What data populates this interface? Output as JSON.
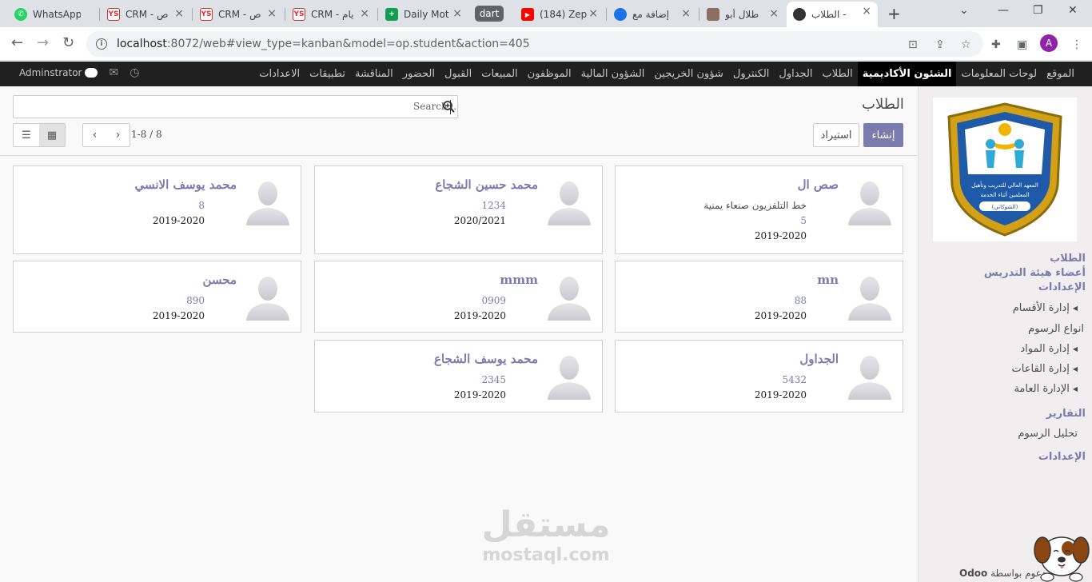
{
  "browser": {
    "tabs": [
      {
        "title": "WhatsApp",
        "fav": "whatsapp",
        "color": "#25d366"
      },
      {
        "title": "CRM - ص",
        "fav": "ys",
        "color": "#fff"
      },
      {
        "title": "CRM - ص",
        "fav": "ys",
        "color": "#fff"
      },
      {
        "title": "CRM - يام",
        "fav": "ys",
        "color": "#fff"
      },
      {
        "title": "Daily Mot",
        "fav": "sheets",
        "color": "#0f9d58"
      },
      {
        "title": "(184) Zep",
        "fav": "youtube",
        "color": "#ff0000"
      },
      {
        "title": "إضافة مع",
        "fav": "circle",
        "color": "#1a73e8"
      },
      {
        "title": "طلال أبو",
        "fav": "book",
        "color": "#8d6e63"
      },
      {
        "title": "الطلاب -",
        "fav": "odoo",
        "color": "#333"
      }
    ],
    "group_label": "dart",
    "url_host": "localhost",
    "url_rest": ":8072/web#view_type=kanban&model=op.student&action=405"
  },
  "menu": {
    "items": [
      "الموقع",
      "لوحات المعلومات",
      "الشئون الأكاديمية",
      "الطلاب",
      "الجداول",
      "الكنترول",
      "شؤون الخريجين",
      "الشؤون المالية",
      "الموظفون",
      "المبيعات",
      "القبول",
      "الحضور",
      "المناقشة",
      "تطبيقات",
      "الاعدادات"
    ],
    "active_index": 2,
    "user": "Adminstrator"
  },
  "control": {
    "breadcrumb": "الطلاب",
    "search_placeholder": "Search...",
    "create_label": "إنشاء",
    "import_label": "استيراد",
    "pager_value": "1-8 / 8"
  },
  "sidebar": {
    "heads": [
      "الطلاب",
      "أعضاء هيئة التدريس",
      "الإعدادات"
    ],
    "sub_items": [
      "إدارة الأقسام",
      "انواع الرسوم",
      "إدارة المواد",
      "إدارة القاعات",
      "الإدارة العامة"
    ],
    "reports_head": "التقارير",
    "report_item": "تحليل الرسوم",
    "settings_head": "الإعدادات",
    "logo_text": [
      "المعهد العالي للتدريب وتأهيل",
      "المعلمين أثناء الخدمة",
      "(الشوكاني)"
    ]
  },
  "cards": [
    {
      "name": "صص ال",
      "line1": "خط التلفزيون صنعاء يمنية",
      "line2": "5",
      "line3": "2019-2020"
    },
    {
      "name": "محمد حسين الشجاع",
      "line1": "",
      "line2": "1234",
      "line3": "2020/2021"
    },
    {
      "name": "محمد يوسف الانسي",
      "line1": "",
      "line2": "8",
      "line3": "2019-2020"
    },
    {
      "name": "mn",
      "line1": "",
      "line2": "88",
      "line3": "2019-2020"
    },
    {
      "name": "mmm",
      "line1": "",
      "line2": "0909",
      "line3": "2019-2020"
    },
    {
      "name": "محسن",
      "line1": "",
      "line2": "890",
      "line3": "2019-2020"
    },
    {
      "name": "الجداول",
      "line1": "",
      "line2": "5432",
      "line3": "2019-2020"
    },
    {
      "name": "محمد يوسف الشجاع",
      "line1": "",
      "line2": "2345",
      "line3": "2019-2020"
    }
  ],
  "watermark": {
    "arabic": "مستقل",
    "latin": "mostaql.com"
  },
  "footer": {
    "powered": "مدعوم بواسطة",
    "brand": "Odoo"
  },
  "colors": {
    "accent": "#7c7bad",
    "menu_bg": "#202020"
  }
}
